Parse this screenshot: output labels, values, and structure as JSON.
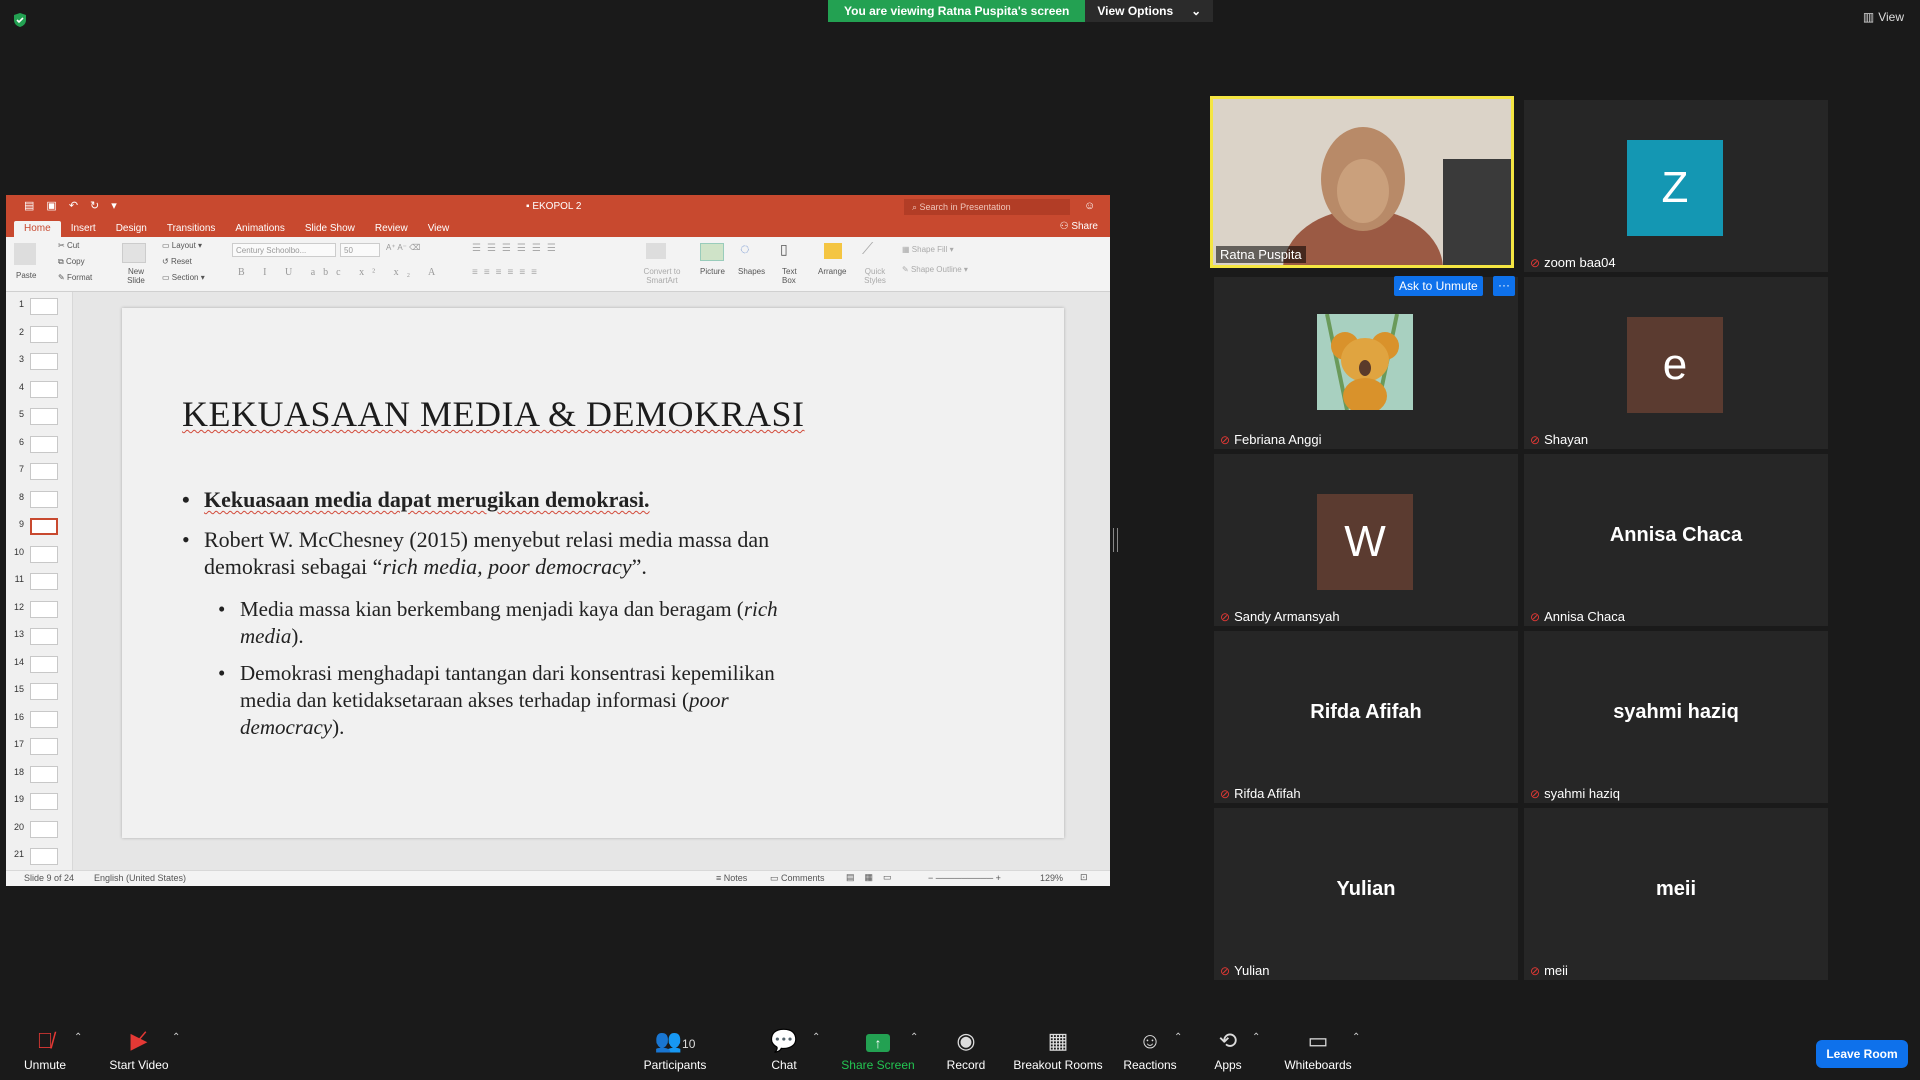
{
  "banner": {
    "viewing": "You are viewing Ratna Puspita's screen",
    "view_options": "View Options"
  },
  "top_right": {
    "view": "View"
  },
  "ppt": {
    "doc_title": "EKOPOL 2",
    "search_placeholder": "Search in Presentation",
    "tabs": [
      "Home",
      "Insert",
      "Design",
      "Transitions",
      "Animations",
      "Slide Show",
      "Review",
      "View"
    ],
    "share": "Share",
    "ribbon": {
      "paste": "Paste",
      "cut": "Cut",
      "copy": "Copy",
      "format": "Format",
      "new_slide": "New Slide",
      "layout": "Layout",
      "reset": "Reset",
      "section": "Section",
      "font": "Century Schoolbo...",
      "font_size": "50",
      "convert": "Convert to SmartArt",
      "picture": "Picture",
      "shapes": "Shapes",
      "text_box": "Text Box",
      "arrange": "Arrange",
      "quick_styles": "Quick Styles",
      "shape_fill": "Shape Fill",
      "shape_outline": "Shape Outline"
    },
    "thumb_numbers": [
      "1",
      "2",
      "3",
      "4",
      "5",
      "6",
      "7",
      "8",
      "9",
      "10",
      "11",
      "12",
      "13",
      "14",
      "15",
      "16",
      "17",
      "18",
      "19",
      "20",
      "21"
    ],
    "active_slide_index": 8,
    "slide": {
      "title": "KEKUASAAN MEDIA & DEMOKRASI",
      "b1": "Kekuasaan media dapat merugikan demokrasi.",
      "b2_a": "Robert W. McChesney (2015) menyebut relasi media massa dan",
      "b2_b": "demokrasi sebagai “",
      "b2_c": "rich media, poor democracy",
      "b2_d": "”.",
      "s1_a": "Media massa kian berkembang menjadi kaya dan beragam (",
      "s1_b": "rich",
      "s1_c": "media",
      "s1_d": ").",
      "s2_a": "Demokrasi menghadapi tantangan dari konsentrasi kepemilikan",
      "s2_b": "media dan ketidaksetaraan akses terhadap informasi (",
      "s2_c": "poor",
      "s2_d": "democracy",
      "s2_e": ")."
    },
    "status": {
      "slide_of": "Slide 9 of 24",
      "lang": "English (United States)",
      "notes": "Notes",
      "comments": "Comments",
      "zoom": "129%"
    }
  },
  "participants": [
    {
      "name": "Ratna Puspita"
    },
    {
      "name": "zoom baa04",
      "initial": "Z"
    },
    {
      "name": "Febriana Anggi"
    },
    {
      "name": "Shayan",
      "initial": "e"
    },
    {
      "name": "Sandy Armansyah",
      "initial": "W"
    },
    {
      "name": "Annisa Chaca"
    },
    {
      "name": "Rifda Afifah"
    },
    {
      "name": "syahmi haziq"
    },
    {
      "name": "Yulian"
    },
    {
      "name": "meii"
    }
  ],
  "ask_unmute": "Ask to Unmute",
  "toolbar": {
    "unmute": "Unmute",
    "start_video": "Start Video",
    "participants": "Participants",
    "participants_count": "10",
    "chat": "Chat",
    "share_screen": "Share Screen",
    "record": "Record",
    "breakout": "Breakout Rooms",
    "reactions": "Reactions",
    "apps": "Apps",
    "whiteboards": "Whiteboards",
    "leave": "Leave Room"
  },
  "colors": {
    "zoom_blue": "#0e71eb",
    "share_green": "#23a152",
    "ppt_red": "#c8492f",
    "active_speaker": "#f5e642"
  }
}
